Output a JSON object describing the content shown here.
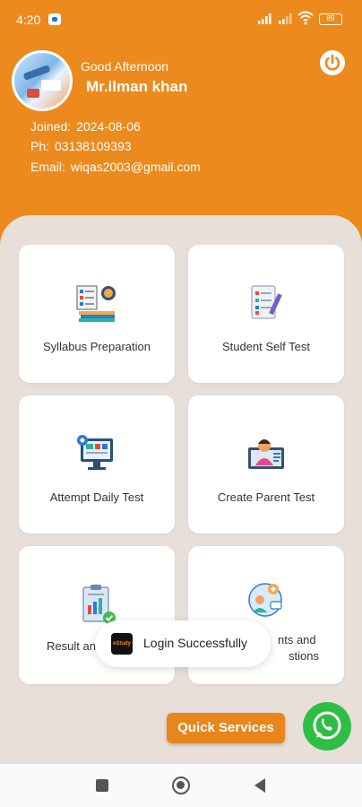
{
  "status_bar": {
    "time": "4:20",
    "battery": "89"
  },
  "profile": {
    "greeting": "Good Afternoon",
    "name": "Mr.ilman khan",
    "joined_label": "Joined:",
    "joined_value": "2024-08-06",
    "phone_label": "Ph:",
    "phone_value": "03138109393",
    "email_label": "Email:",
    "email_value": "wiqas2003@gmail.com"
  },
  "menu": [
    {
      "label": "Syllabus Preparation",
      "icon": "books-globe-icon"
    },
    {
      "label": "Student Self Test",
      "icon": "checklist-pencil-icon"
    },
    {
      "label": "Attempt Daily Test",
      "icon": "monitor-gear-icon"
    },
    {
      "label": "Create Parent Test",
      "icon": "parent-laptop-icon"
    },
    {
      "label": "Result and Reports",
      "visible_label_left": "Result an",
      "icon": "clipboard-chart-icon"
    },
    {
      "label": "Complaints and Suggestions",
      "visible_label_line1": "nts and",
      "visible_label_line2": "stions",
      "icon": "feedback-thumbs-icon"
    }
  ],
  "toast": {
    "text": "Login Successfully",
    "logo_text": "eStudy"
  },
  "quick_services": {
    "label": "Quick Services"
  },
  "colors": {
    "accent": "#ec8a1e",
    "background": "#e8e0d8",
    "whatsapp": "#2fbe45"
  }
}
